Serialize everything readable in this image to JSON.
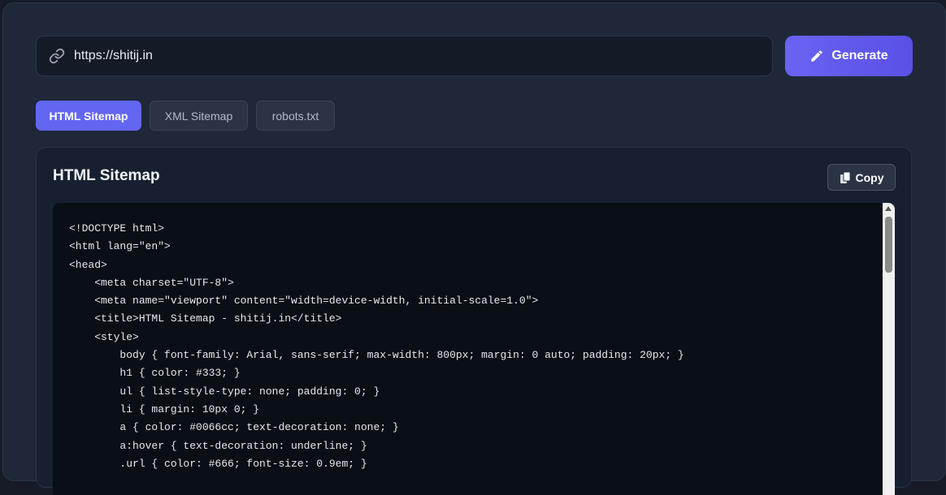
{
  "url_input": {
    "value": "https://shitij.in",
    "icon": "link-icon"
  },
  "generate_button": {
    "label": "Generate",
    "icon": "pencil-icon"
  },
  "tabs": [
    {
      "label": "HTML Sitemap",
      "active": true
    },
    {
      "label": "XML Sitemap",
      "active": false
    },
    {
      "label": "robots.txt",
      "active": false
    }
  ],
  "card": {
    "title": "HTML Sitemap",
    "copy_label": "Copy",
    "copy_icon": "copy-icon"
  },
  "code_lines": [
    "<!DOCTYPE html>",
    "<html lang=\"en\">",
    "<head>",
    "    <meta charset=\"UTF-8\">",
    "    <meta name=\"viewport\" content=\"width=device-width, initial-scale=1.0\">",
    "    <title>HTML Sitemap - shitij.in</title>",
    "    <style>",
    "        body { font-family: Arial, sans-serif; max-width: 800px; margin: 0 auto; padding: 20px; }",
    "        h1 { color: #333; }",
    "        ul { list-style-type: none; padding: 0; }",
    "        li { margin: 10px 0; }",
    "        a { color: #0066cc; text-decoration: none; }",
    "        a:hover { text-decoration: underline; }",
    "        .url { color: #666; font-size: 0.9em; }"
  ],
  "colors": {
    "accent": "#6366f1",
    "panel": "#1f2839",
    "code_bg": "#0a0e15"
  }
}
